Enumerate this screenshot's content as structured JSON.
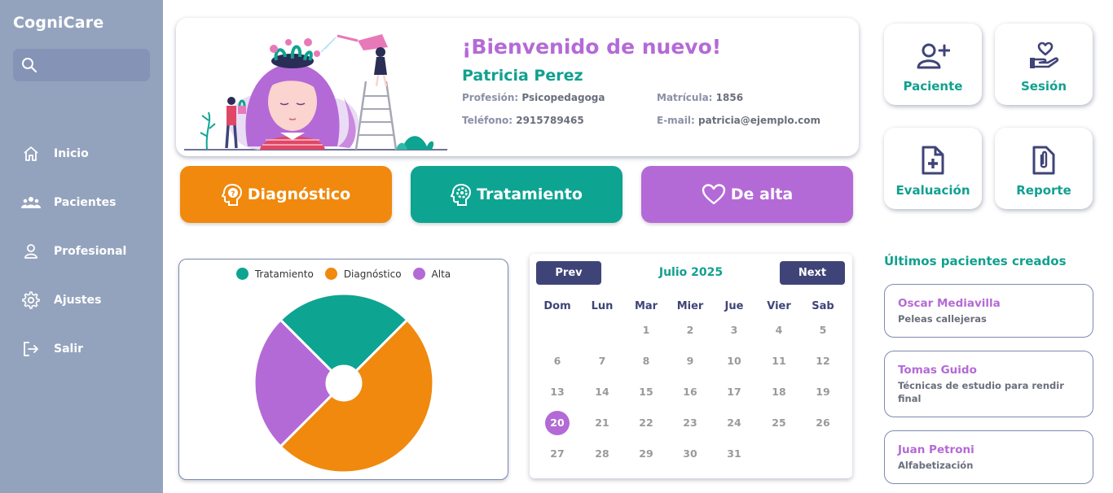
{
  "app": {
    "name": "CogniCare"
  },
  "search": {
    "placeholder": ""
  },
  "nav": [
    {
      "label": "Inicio",
      "icon": "home-icon"
    },
    {
      "label": "Pacientes",
      "icon": "users-icon"
    },
    {
      "label": "Profesional",
      "icon": "user-icon"
    },
    {
      "label": "Ajustes",
      "icon": "gear-icon"
    },
    {
      "label": "Salir",
      "icon": "logout-icon"
    }
  ],
  "welcome": {
    "title": "¡Bienvenido de nuevo!",
    "name": "Patricia Perez",
    "profesion_label": "Profesión:",
    "profesion": "Psicopedagoga",
    "matricula_label": "Matrícula:",
    "matricula": "1856",
    "telefono_label": "Teléfono:",
    "telefono": "2915789465",
    "email_label": "E-mail:",
    "email": "patricia@ejemplo.com"
  },
  "status_buttons": [
    {
      "label": "Diagnóstico",
      "color": "#f0890d",
      "icon": "head-question-icon"
    },
    {
      "label": "Tratamiento",
      "color": "#0ea492",
      "icon": "head-gear-icon"
    },
    {
      "label": "De alta",
      "color": "#b46ad6",
      "icon": "heart-icon"
    }
  ],
  "actions": [
    {
      "label": "Paciente",
      "icon": "user-plus-icon"
    },
    {
      "label": "Sesión",
      "icon": "hand-heart-icon"
    },
    {
      "label": "Evaluación",
      "icon": "file-plus-icon"
    },
    {
      "label": "Reporte",
      "icon": "paperclip-file-icon"
    }
  ],
  "chart_data": {
    "type": "pie",
    "legend_position": "top",
    "series": [
      {
        "name": "Tratamiento",
        "value": 1,
        "color": "#0ea492"
      },
      {
        "name": "Diagnóstico",
        "value": 2,
        "color": "#f0890d"
      },
      {
        "name": "Alta",
        "value": 1,
        "color": "#b46ad6"
      }
    ]
  },
  "calendar": {
    "prev_label": "Prev",
    "next_label": "Next",
    "title": "Julio 2025",
    "weekdays": [
      "Dom",
      "Lun",
      "Mar",
      "Mier",
      "Jue",
      "Vier",
      "Sab"
    ],
    "weeks": [
      [
        "",
        "",
        "1",
        "2",
        "3",
        "4",
        "5"
      ],
      [
        "6",
        "7",
        "8",
        "9",
        "10",
        "11",
        "12"
      ],
      [
        "13",
        "14",
        "15",
        "16",
        "17",
        "18",
        "19"
      ],
      [
        "20",
        "21",
        "22",
        "23",
        "24",
        "25",
        "26"
      ],
      [
        "27",
        "28",
        "29",
        "30",
        "31",
        "",
        ""
      ]
    ],
    "today": "20"
  },
  "recent": {
    "title": "Últimos pacientes creados",
    "patients": [
      {
        "name": "Oscar Mediavilla",
        "desc": "Peleas callejeras"
      },
      {
        "name": "Tomas Guido",
        "desc": "Técnicas de estudio para rendir final"
      },
      {
        "name": "Juan Petroni",
        "desc": "Alfabetización"
      }
    ]
  },
  "colors": {
    "sidebar": "#94a3bd",
    "accent_teal": "#0ea492",
    "accent_purple": "#b46ad6",
    "accent_orange": "#f0890d",
    "navy": "#3f4478"
  }
}
